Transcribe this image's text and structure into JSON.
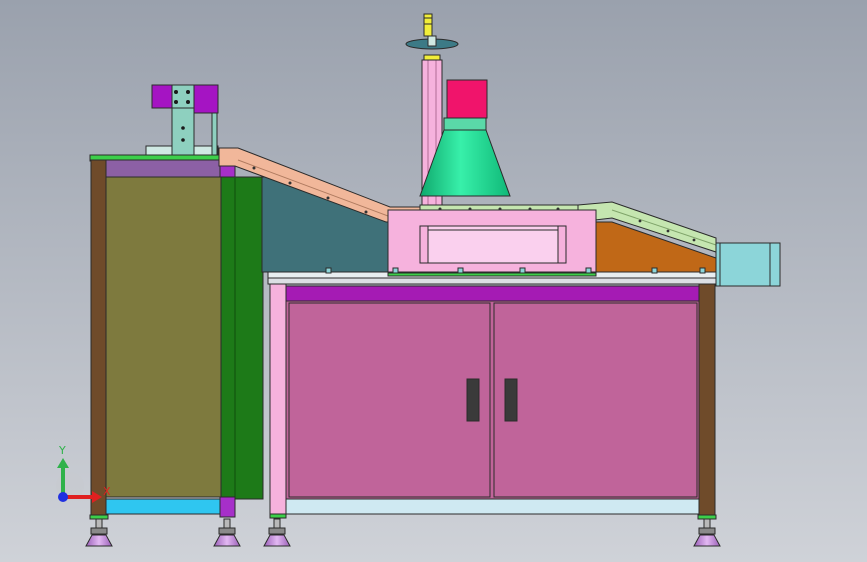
{
  "viewport": {
    "background_top": "#9aa1ad",
    "background_bottom": "#cfd2d8"
  },
  "colors": {
    "outline": "#2b2b2b",
    "olive_panel": "#7e7a3e",
    "dark_green_panel": "#1d7a18",
    "wood_post": "#6f4b2a",
    "magenta_cabinet": "#c0649a",
    "magenta_header": "#a51bb4",
    "light_pink_housing": "#f6b2dd",
    "salmon_chute": "#f1b79a",
    "teal_backplate": "#3f7179",
    "orange_plate": "#c06817",
    "pale_green_chute": "#c5e6b0",
    "light_cyan_box": "#8cd5d9",
    "cyan_base_strip": "#2fc6f0",
    "purple_top_block": "#a62fc9",
    "red_motor": "#f0146b",
    "green_hood": "#18d890",
    "yellow_tip": "#f1ee3a",
    "violet_feet": "#c78de0",
    "tabletop": "#e8eef0",
    "lavender_strip": "#8c60a5"
  },
  "icons": {
    "triad": "coordinate-triad-icon"
  },
  "axes_triad": {
    "y_label": "Y",
    "x_label": "X"
  }
}
